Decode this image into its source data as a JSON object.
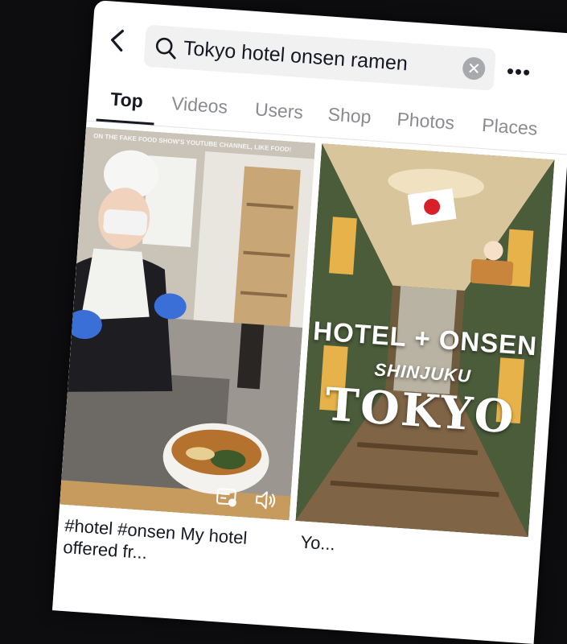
{
  "search": {
    "query": "Tokyo hotel onsen ramen"
  },
  "tabs": [
    {
      "label": "Top",
      "active": true
    },
    {
      "label": "Videos"
    },
    {
      "label": "Users"
    },
    {
      "label": "Shop"
    },
    {
      "label": "Photos"
    },
    {
      "label": "Places"
    }
  ],
  "results": [
    {
      "caption": "#hotel #onsen My hotel offered fr...",
      "thumb_hint": "ON THE FAKE FOOD SHOW'S YOUTUBE CHANNEL, LIKE FOOD!"
    },
    {
      "caption": "Yo...",
      "overlay_line1": "HOTEL + ONSEN",
      "overlay_line2": "SHINJUKU",
      "overlay_line3": "TOKYO"
    }
  ],
  "colors": {
    "text": "#161823",
    "tab_inactive": "#8a8b91",
    "search_bg": "#f1f1f2"
  },
  "icons": [
    "back-arrow-icon",
    "search-icon",
    "clear-icon",
    "more-icon",
    "caption-icon",
    "sound-icon"
  ]
}
